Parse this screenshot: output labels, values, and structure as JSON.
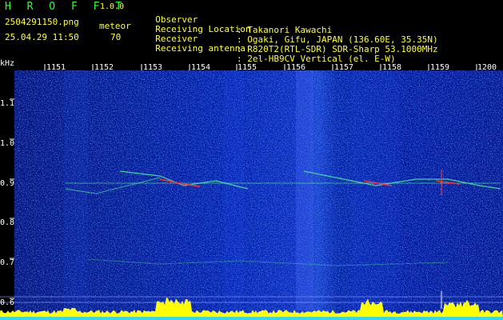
{
  "header": {
    "app_name": "H R O F F T",
    "version": "1.0.0",
    "filename": "2504291150.png",
    "datetime": "25.04.29 11:50",
    "mode_label": "meteor",
    "count": "70",
    "info": [
      {
        "key": "Observer",
        "value": ": Takanori Kawachi"
      },
      {
        "key": "Receiving Location",
        "value": ": Ogaki, Gifu, JAPAN (136.60E, 35.35N)"
      },
      {
        "key": "Receiver",
        "value": ": R820T2(RTL-SDR) SDR-Sharp 53.1000MHz"
      },
      {
        "key": "Receiving antenna",
        "value": ": 2el-HB9CV Vertical (el. E-W)"
      }
    ]
  },
  "spectrogram": {
    "y_unit": "kHz",
    "y_ticks": [
      "1.1",
      "1.0",
      "0.9",
      "0.8",
      "0.7",
      "0.6"
    ],
    "time_ticks": [
      "1151",
      "1152",
      "1153",
      "1154",
      "1155",
      "1156",
      "1157",
      "1158",
      "1159",
      "1200"
    ],
    "colors": {
      "background": "#00008a",
      "noise": "#3c64ff",
      "echo": "#ff3030",
      "trail": "#50ff90",
      "baseline": "#ffff00"
    }
  }
}
